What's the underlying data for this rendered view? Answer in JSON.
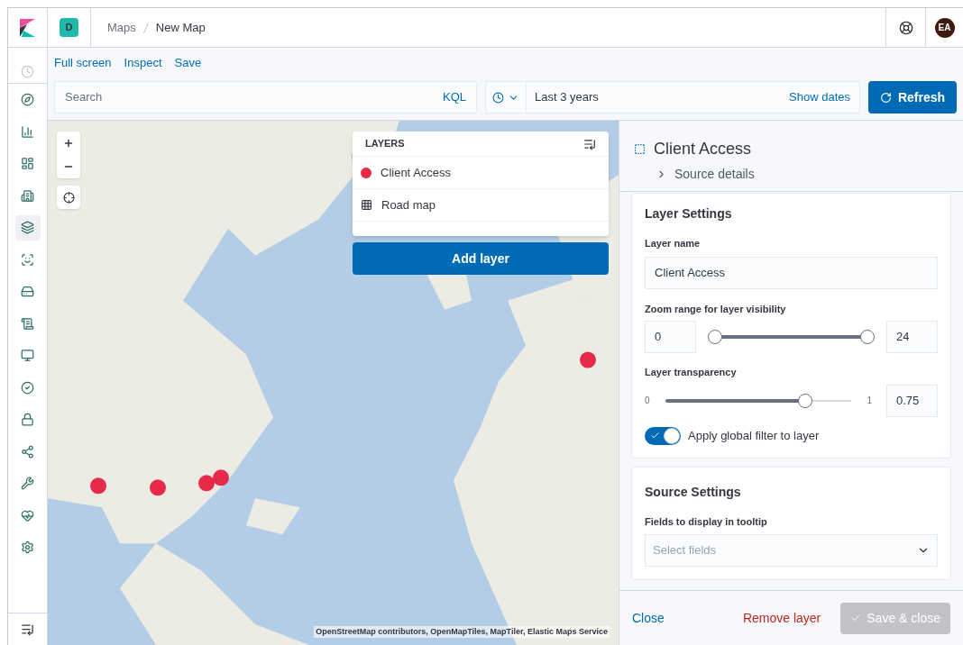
{
  "header": {
    "space_badge": "D",
    "breadcrumbs": [
      {
        "label": "Maps",
        "current": false
      },
      {
        "label": "New Map",
        "current": true
      }
    ],
    "avatar": "EA"
  },
  "nav": [
    {
      "selected": false
    },
    {
      "selected": false
    },
    {
      "selected": false
    },
    {
      "selected": false
    },
    {
      "selected": false
    },
    {
      "selected": true
    },
    {
      "selected": false
    },
    {
      "selected": false
    },
    {
      "selected": false
    },
    {
      "selected": false
    },
    {
      "selected": false
    },
    {
      "selected": false
    },
    {
      "selected": false
    },
    {
      "selected": false
    },
    {
      "selected": false
    },
    {
      "selected": false
    }
  ],
  "toolbar": {
    "links": [
      "Full screen",
      "Inspect",
      "Save"
    ],
    "search": {
      "placeholder": "Search",
      "language": "KQL"
    },
    "date": {
      "value": "Last 3 years",
      "show_dates": "Show dates"
    },
    "refresh": "Refresh"
  },
  "map": {
    "attribution": "OpenStreetMap contributors, OpenMapTiles, MapTiler, Elastic Maps Service",
    "layers_title": "LAYERS",
    "layers": [
      {
        "kind": "dot",
        "name": "Client Access",
        "color": "#e7294a"
      },
      {
        "kind": "grid",
        "name": "Road map"
      }
    ],
    "add_layer": "Add layer"
  },
  "panel": {
    "title": "Client Access",
    "source_details": "Source details",
    "layer_settings": {
      "heading": "Layer Settings",
      "name_label": "Layer name",
      "name_value": "Client Access",
      "zoom_label": "Zoom range for layer visibility",
      "zoom_min": "0",
      "zoom_max": "24",
      "zoom_low": {
        "level": 0
      },
      "zoom_high": {
        "level": 1
      },
      "transparency_label": "Layer transparency",
      "range_min": "0",
      "range_max": "1",
      "transparency": {
        "level": 0.75
      },
      "transparency_value": "0.75",
      "global_filter": {
        "label": "Apply global filter to layer",
        "on": true
      }
    },
    "source_settings": {
      "heading": "Source Settings",
      "fields_label": "Fields to display in tooltip",
      "fields_placeholder": "Select fields"
    },
    "footer": {
      "close": "Close",
      "remove": "Remove layer",
      "save": "Save & close",
      "save_disabled": true
    }
  }
}
